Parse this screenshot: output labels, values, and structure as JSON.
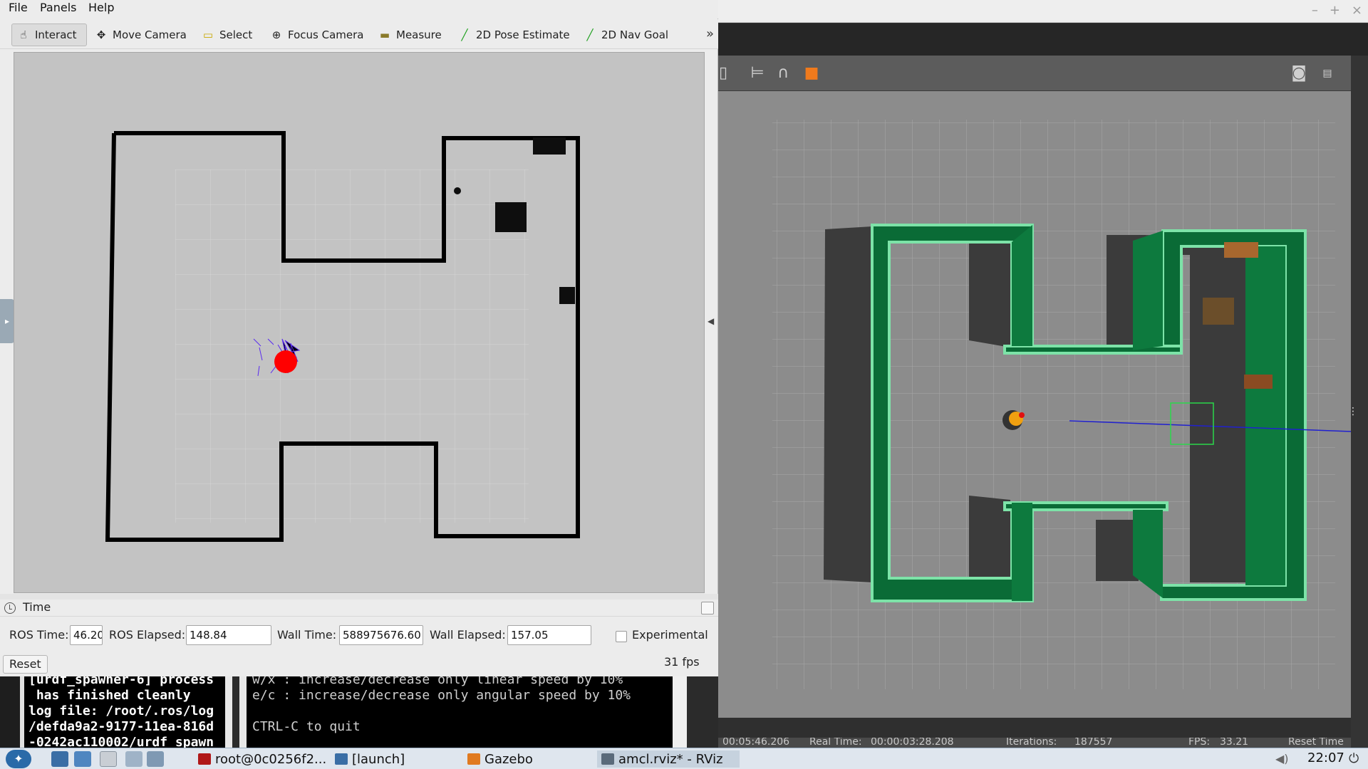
{
  "rviz": {
    "menu": [
      "File",
      "Panels",
      "Help"
    ],
    "tools": [
      {
        "label": "Interact",
        "icon": "hand-icon"
      },
      {
        "label": "Move Camera",
        "icon": "move-camera-icon"
      },
      {
        "label": "Select",
        "icon": "select-icon"
      },
      {
        "label": "Focus Camera",
        "icon": "focus-camera-icon"
      },
      {
        "label": "Measure",
        "icon": "ruler-icon"
      },
      {
        "label": "2D Pose Estimate",
        "icon": "green-arrow-icon"
      },
      {
        "label": "2D Nav Goal",
        "icon": "green-arrow-icon"
      }
    ],
    "more": "»",
    "time_panel": {
      "title": "Time",
      "ros_time_label": "ROS Time:",
      "ros_time_value": "46.20",
      "ros_elapsed_label": "ROS Elapsed:",
      "ros_elapsed_value": "148.84",
      "wall_time_label": "Wall Time:",
      "wall_time_value": "588975676.60",
      "wall_elapsed_label": "Wall Elapsed:",
      "wall_elapsed_value": "157.05",
      "experimental_label": "Experimental",
      "experimental_checked": false,
      "reset_label": "Reset",
      "fps": "31 fps"
    },
    "colors": {
      "robot": "#ff0000",
      "particles": "#5a2cf0",
      "walls": "#000000"
    }
  },
  "gazebo": {
    "status": {
      "sim_time": "00:05:46.206",
      "real_time_label": "Real Time:",
      "real_time_value": "00:00:03:28.208",
      "iterations_label": "Iterations:",
      "iterations_value": "187557",
      "fps_label": "FPS:",
      "fps_value": "33.21",
      "reset_time_label": "Reset Time"
    },
    "colors": {
      "wall_top": "#0a6b36",
      "wall_edge": "#7de3a8",
      "ground": "#8c8c8c"
    }
  },
  "terminal1": {
    "lines": [
      "[urdf_spawner-6] process",
      " has finished cleanly",
      "log file: /root/.ros/log",
      "/defda9a2-9177-11ea-816d",
      "-0242ac110002/urdf_spawn"
    ]
  },
  "terminal2": {
    "lines": [
      "w/x : increase/decrease only linear speed by 10%",
      "e/c : increase/decrease only angular speed by 10%",
      "",
      "CTRL-C to quit"
    ]
  },
  "taskbar": {
    "tasks": [
      "root@0c0256f2...",
      "[launch]",
      "Gazebo",
      "amcl.rviz* - RViz"
    ],
    "clock": "22:07"
  }
}
